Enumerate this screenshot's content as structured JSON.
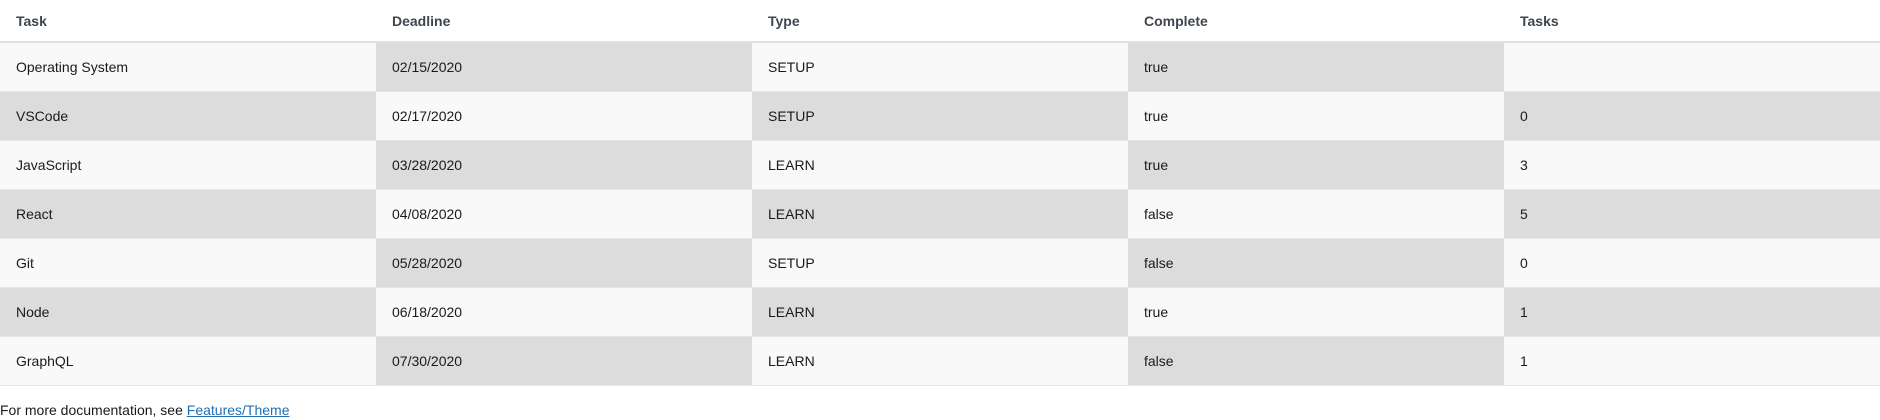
{
  "table": {
    "columns": [
      "Task",
      "Deadline",
      "Type",
      "Complete",
      "Tasks"
    ],
    "rows": [
      [
        "Operating System",
        "02/15/2020",
        "SETUP",
        "true",
        ""
      ],
      [
        "VSCode",
        "02/17/2020",
        "SETUP",
        "true",
        "0"
      ],
      [
        "JavaScript",
        "03/28/2020",
        "LEARN",
        "true",
        "3"
      ],
      [
        "React",
        "04/08/2020",
        "LEARN",
        "false",
        "5"
      ],
      [
        "Git",
        "05/28/2020",
        "SETUP",
        "false",
        "0"
      ],
      [
        "Node",
        "06/18/2020",
        "LEARN",
        "true",
        "1"
      ],
      [
        "GraphQL",
        "07/30/2020",
        "LEARN",
        "false",
        "1"
      ]
    ]
  },
  "footer": {
    "text": "For more documentation, see ",
    "link": "Features/Theme"
  }
}
